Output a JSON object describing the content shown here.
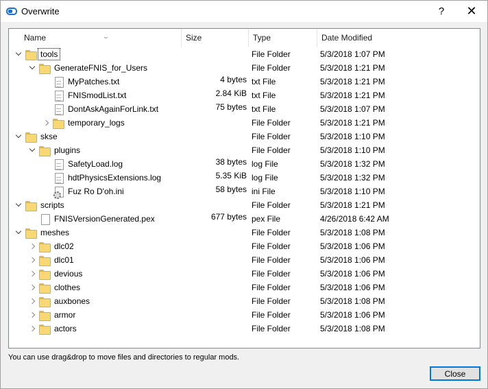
{
  "window": {
    "title": "Overwrite",
    "help_label": "?",
    "close_label": "✕"
  },
  "columns": {
    "name": "Name",
    "size": "Size",
    "type": "Type",
    "date": "Date Modified"
  },
  "rows": [
    {
      "indent": 0,
      "expander": "down",
      "icon": "folder",
      "name": "tools",
      "size": "",
      "type": "File Folder",
      "date": "5/3/2018 1:07 PM",
      "focused": true
    },
    {
      "indent": 1,
      "expander": "down",
      "icon": "folder",
      "name": "GenerateFNIS_for_Users",
      "size": "",
      "type": "File Folder",
      "date": "5/3/2018 1:21 PM"
    },
    {
      "indent": 2,
      "expander": "none",
      "icon": "file",
      "name": "MyPatches.txt",
      "size": "4 bytes",
      "type": "txt File",
      "date": "5/3/2018 1:21 PM"
    },
    {
      "indent": 2,
      "expander": "none",
      "icon": "file",
      "name": "FNISmodList.txt",
      "size": "2.84 KiB",
      "type": "txt File",
      "date": "5/3/2018 1:21 PM"
    },
    {
      "indent": 2,
      "expander": "none",
      "icon": "file",
      "name": "DontAskAgainForLink.txt",
      "size": "75 bytes",
      "type": "txt File",
      "date": "5/3/2018 1:07 PM"
    },
    {
      "indent": 2,
      "expander": "right",
      "icon": "folder",
      "name": "temporary_logs",
      "size": "",
      "type": "File Folder",
      "date": "5/3/2018 1:21 PM"
    },
    {
      "indent": 0,
      "expander": "down",
      "icon": "folder",
      "name": "skse",
      "size": "",
      "type": "File Folder",
      "date": "5/3/2018 1:10 PM"
    },
    {
      "indent": 1,
      "expander": "down",
      "icon": "folder",
      "name": "plugins",
      "size": "",
      "type": "File Folder",
      "date": "5/3/2018 1:10 PM"
    },
    {
      "indent": 2,
      "expander": "none",
      "icon": "file",
      "name": "SafetyLoad.log",
      "size": "38 bytes",
      "type": "log File",
      "date": "5/3/2018 1:32 PM"
    },
    {
      "indent": 2,
      "expander": "none",
      "icon": "file",
      "name": "hdtPhysicsExtensions.log",
      "size": "5.35 KiB",
      "type": "log File",
      "date": "5/3/2018 1:32 PM"
    },
    {
      "indent": 2,
      "expander": "none",
      "icon": "ini",
      "name": "Fuz Ro D'oh.ini",
      "size": "58 bytes",
      "type": "ini File",
      "date": "5/3/2018 1:10 PM"
    },
    {
      "indent": 0,
      "expander": "down",
      "icon": "folder",
      "name": "scripts",
      "size": "",
      "type": "File Folder",
      "date": "5/3/2018 1:21 PM"
    },
    {
      "indent": 1,
      "expander": "none",
      "icon": "blank",
      "name": "FNISVersionGenerated.pex",
      "size": "677 bytes",
      "type": "pex File",
      "date": "4/26/2018 6:42 AM"
    },
    {
      "indent": 0,
      "expander": "down",
      "icon": "folder",
      "name": "meshes",
      "size": "",
      "type": "File Folder",
      "date": "5/3/2018 1:08 PM"
    },
    {
      "indent": 1,
      "expander": "right",
      "icon": "folder",
      "name": "dlc02",
      "size": "",
      "type": "File Folder",
      "date": "5/3/2018 1:06 PM"
    },
    {
      "indent": 1,
      "expander": "right",
      "icon": "folder",
      "name": "dlc01",
      "size": "",
      "type": "File Folder",
      "date": "5/3/2018 1:06 PM"
    },
    {
      "indent": 1,
      "expander": "right",
      "icon": "folder",
      "name": "devious",
      "size": "",
      "type": "File Folder",
      "date": "5/3/2018 1:06 PM"
    },
    {
      "indent": 1,
      "expander": "right",
      "icon": "folder",
      "name": "clothes",
      "size": "",
      "type": "File Folder",
      "date": "5/3/2018 1:06 PM"
    },
    {
      "indent": 1,
      "expander": "right",
      "icon": "folder",
      "name": "auxbones",
      "size": "",
      "type": "File Folder",
      "date": "5/3/2018 1:08 PM"
    },
    {
      "indent": 1,
      "expander": "right",
      "icon": "folder",
      "name": "armor",
      "size": "",
      "type": "File Folder",
      "date": "5/3/2018 1:06 PM"
    },
    {
      "indent": 1,
      "expander": "right",
      "icon": "folder",
      "name": "actors",
      "size": "",
      "type": "File Folder",
      "date": "5/3/2018 1:08 PM"
    }
  ],
  "footer": {
    "hint": "You can use drag&drop to move files and directories to regular mods.",
    "close_button": "Close"
  }
}
